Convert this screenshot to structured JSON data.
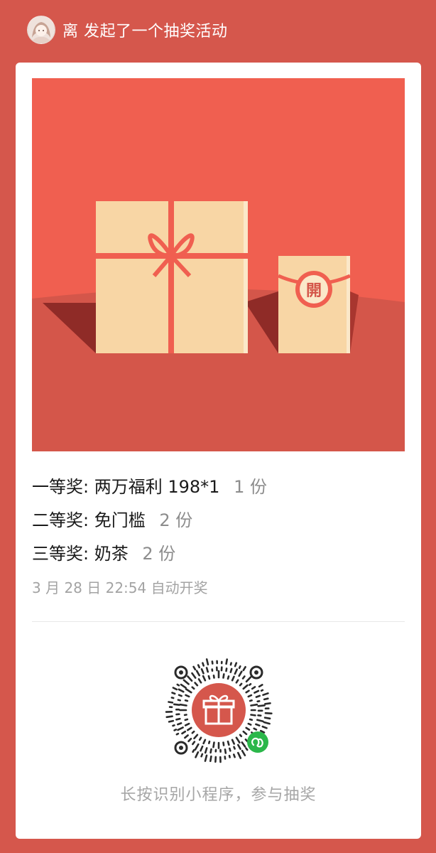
{
  "header": {
    "user_name": "离",
    "action_text": "发起了一个抽奖活动",
    "avatar_icon": "avatar-icon"
  },
  "banner": {
    "gift_icon": "gift-box-icon",
    "envelope_icon": "red-envelope-icon",
    "envelope_seal": "開",
    "colors": {
      "background": "#f05f50",
      "floor": "#d4564a",
      "box": "#f8d6a5",
      "ribbon": "#f05f50",
      "shadow": "#8f2b27"
    }
  },
  "prizes": [
    {
      "tier": "一等奖:",
      "name": "两万福利 198*1",
      "count": "1 份"
    },
    {
      "tier": "二等奖:",
      "name": "免门槛",
      "count": "2 份"
    },
    {
      "tier": "三等奖:",
      "name": "奶茶",
      "count": "2 份"
    }
  ],
  "draw_time": "3 月 28 日 22:54 自动开奖",
  "qr": {
    "icon": "mini-program-code-icon",
    "center_icon": "gift-icon",
    "badge_icon": "wechat-mini-program-icon",
    "caption": "长按识别小程序，参与抽奖"
  },
  "colors": {
    "page_background": "#d5574c",
    "card_background": "#ffffff",
    "accent": "#d5574c",
    "badge_green": "#2bb74a"
  }
}
